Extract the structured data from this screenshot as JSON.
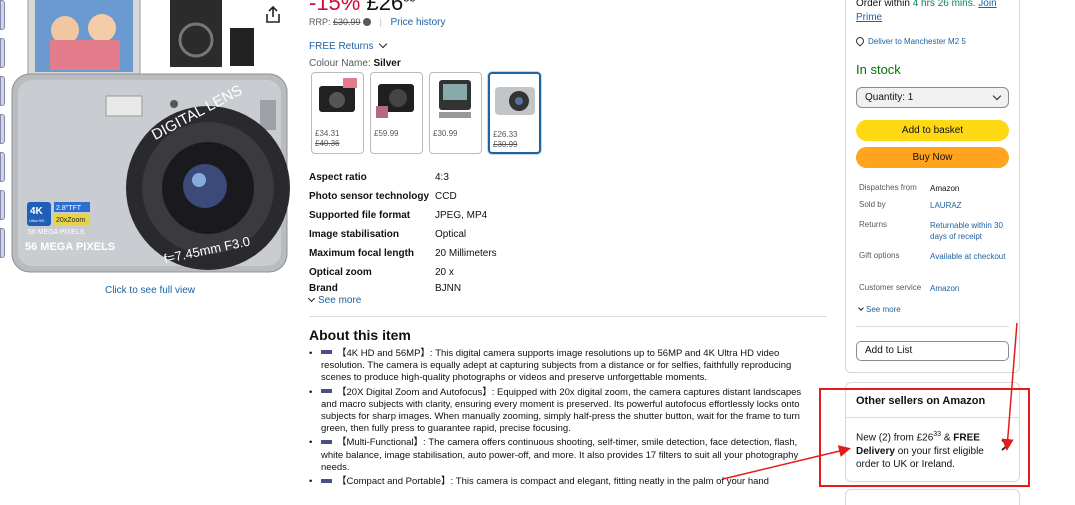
{
  "gallery": {
    "full_view": "Click to see full view",
    "camera_badges": {
      "resolution": "4K",
      "ultra_hd": "Ultra HD",
      "screen": "2.8\"TFT",
      "zoom": "20xZoom",
      "megapixels_small": "56 MEGA PIXELS",
      "megapixels": "56 MEGA PIXELS",
      "lens_brand": "DIGITAL LENS",
      "lens_spec": "f=7.45mm F3.0"
    }
  },
  "price": {
    "discount": "-15%",
    "amount": "£26",
    "fraction": "33",
    "rrp_label": "RRP:",
    "rrp_value": "£30.99",
    "history": "Price history"
  },
  "free_returns": "FREE Returns",
  "colour": {
    "label": "Colour Name:",
    "value": "Silver"
  },
  "swatches": [
    {
      "price": "£34.31",
      "old": "£40.36"
    },
    {
      "price": "£59.99",
      "old": ""
    },
    {
      "price": "£30.99",
      "old": ""
    },
    {
      "price": "£26.33",
      "old": "£30.99"
    }
  ],
  "specs": [
    {
      "k": "Aspect ratio",
      "v": "4:3"
    },
    {
      "k": "Photo sensor technology",
      "v": "CCD"
    },
    {
      "k": "Supported file format",
      "v": "JPEG, MP4"
    },
    {
      "k": "Image stabilisation",
      "v": "Optical"
    },
    {
      "k": "Maximum focal length",
      "v": "20 Millimeters"
    },
    {
      "k": "Optical zoom",
      "v": "20 x"
    },
    {
      "k": "Brand",
      "v": "BJNN"
    }
  ],
  "see_more": "See more",
  "about": {
    "title": "About this item",
    "bullets": [
      "【4K HD and 56MP】: This digital camera supports image resolutions up to 56MP and 4K Ultra HD video resolution. The camera is equally adept at capturing subjects from a distance or for selfies, faithfully reproducing scenes to produce high-quality photographs or videos and preserve unforgettable moments.",
      "【20X Digital Zoom and Autofocus】: Equipped with 20x digital zoom, the camera captures distant landscapes and macro subjects with clarity, ensuring every moment is preserved. Its powerful autofocus effortlessly locks onto subjects for sharp images. When manually zooming, simply half-press the shutter button, wait for the frame to turn green, then fully press to guarantee rapid, precise focusing.",
      "【Multi-Functional】: The camera offers continuous shooting, self-timer, smile detection, face detection, flash, white balance, image stabilisation, auto power-off, and more. It also provides 17 filters to suit all your photography needs.",
      "【Compact and Portable】: This camera is compact and elegant, fitting neatly in the palm of your hand"
    ]
  },
  "buybox": {
    "order_prefix": "Order within",
    "order_time": "4 hrs 26 mins.",
    "join": "Join Prime",
    "deliver": "Deliver to Manchester M2 5",
    "in_stock": "In stock",
    "quantity": "Quantity: 1",
    "add_basket": "Add to basket",
    "buy_now": "Buy Now",
    "details": [
      {
        "k": "Dispatches from",
        "v": "Amazon",
        "link": false
      },
      {
        "k": "Sold by",
        "v": "LAURAZ",
        "link": true
      },
      {
        "k": "Returns",
        "v": "Returnable within 30 days of receipt",
        "link": true
      },
      {
        "k": "Gift options",
        "v": "Available at checkout",
        "link": true
      },
      {
        "k": "Customer service",
        "v": "Amazon",
        "link": true
      }
    ],
    "see_more": "See more",
    "add_list": "Add to List"
  },
  "other_sellers": {
    "title": "Other sellers on Amazon",
    "new_prefix": "New (2) from",
    "price": "£26",
    "fraction": "33",
    "and": "&",
    "free": "FREE",
    "delivery": "Delivery",
    "rest": "on your first eligible order to UK or Ireland."
  },
  "colors": {
    "link": "#2162a1",
    "basket": "#ffd814",
    "buy": "#ffa41c",
    "stock": "#007600",
    "annotation": "#e31b1b"
  }
}
